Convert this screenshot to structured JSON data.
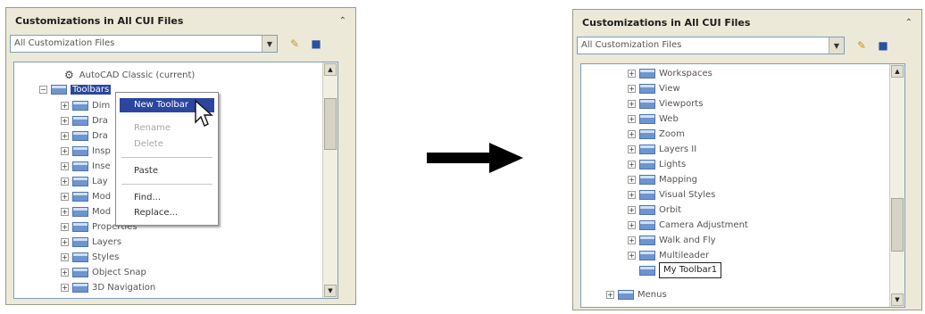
{
  "left_panel": {
    "title": "Customizations in All CUI Files",
    "collapse_icon": "double-chevron-up-icon",
    "combo_value": "All Customization Files",
    "tree_rows": [
      {
        "label": "AutoCAD Classic (current)",
        "icon": "gear-icon"
      },
      {
        "label": "Toolbars",
        "icon": "toolbar-icon",
        "selected": true
      },
      {
        "label": "Dim",
        "icon": "toolbar-icon"
      },
      {
        "label": "Dra",
        "icon": "toolbar-icon"
      },
      {
        "label": "Dra",
        "icon": "toolbar-icon"
      },
      {
        "label": "Insp",
        "icon": "toolbar-icon"
      },
      {
        "label": "Inse",
        "icon": "toolbar-icon"
      },
      {
        "label": "Lay",
        "icon": "toolbar-icon"
      },
      {
        "label": "Mod",
        "icon": "toolbar-icon"
      },
      {
        "label": "Mod",
        "icon": "toolbar-icon"
      },
      {
        "label": "Properties",
        "icon": "toolbar-icon"
      },
      {
        "label": "Layers",
        "icon": "toolbar-icon"
      },
      {
        "label": "Styles",
        "icon": "toolbar-icon"
      },
      {
        "label": "Object Snap",
        "icon": "toolbar-icon"
      },
      {
        "label": "3D Navigation",
        "icon": "toolbar-icon"
      }
    ],
    "context_menu": {
      "new_toolbar": "New Toolbar",
      "rename": "Rename",
      "delete": "Delete",
      "paste": "Paste",
      "find": "Find...",
      "replace": "Replace..."
    }
  },
  "right_panel": {
    "title": "Customizations in All CUI Files",
    "collapse_icon": "double-chevron-up-icon",
    "combo_value": "All Customization Files",
    "tree_rows": [
      {
        "label": "Workspaces"
      },
      {
        "label": "View"
      },
      {
        "label": "Viewports"
      },
      {
        "label": "Web"
      },
      {
        "label": "Zoom"
      },
      {
        "label": "Layers II"
      },
      {
        "label": "Lights"
      },
      {
        "label": "Mapping"
      },
      {
        "label": "Visual Styles"
      },
      {
        "label": "Orbit"
      },
      {
        "label": "Camera Adjustment"
      },
      {
        "label": "Walk and Fly"
      },
      {
        "label": "Multileader"
      },
      {
        "label": "My Toolbar1",
        "editing": true
      },
      {
        "label": "Menus"
      }
    ]
  },
  "transition_arrow": "right-arrow-icon"
}
